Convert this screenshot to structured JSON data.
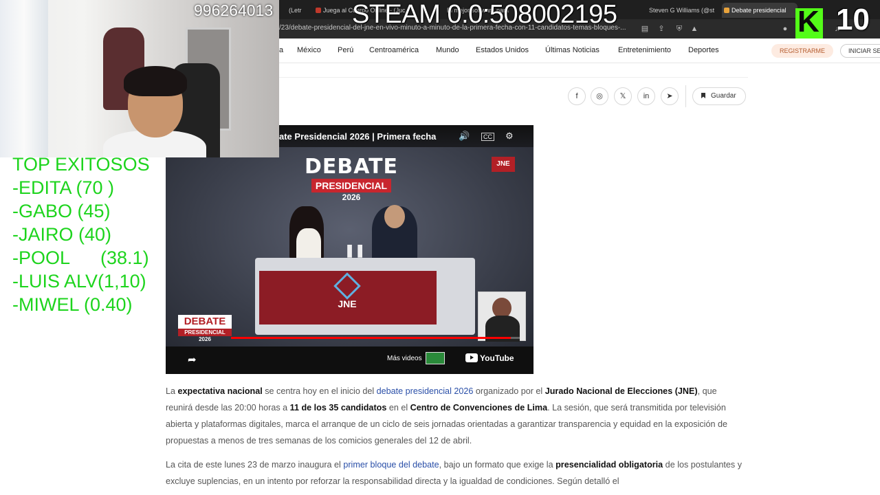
{
  "browser": {
    "tabs": [
      {
        "label": "(Letr"
      },
      {
        "label": "Juega al Cuerpo Online - (Juc"
      },
      {
        "label": "El mejor software para"
      },
      {
        "label": "Steven G Williams (@st"
      },
      {
        "label": "Debate presidencial"
      }
    ],
    "url": "/23/debate-presidencial-del-jne-en-vivo-minuto-a-minuto-de-la-primera-fecha-con-11-candidatos-temas-bloques-..."
  },
  "site_nav": {
    "items": [
      "México",
      "Perú",
      "Centroamérica",
      "Mundo",
      "Estados Unidos",
      "Últimas Noticias",
      "Entretenimiento",
      "Deportes"
    ],
    "register": "REGISTRARME",
    "login": "INICIAR SE"
  },
  "share": {
    "icons": [
      "f",
      "◎",
      "𝕏",
      "in",
      "➤"
    ],
    "save_label": "Guardar"
  },
  "video": {
    "title": "ate Presidencial 2026 | Primera fecha",
    "logo_word": "DEBATE",
    "logo_banner": "PRESIDENCIAL",
    "logo_year": "2026",
    "corner_logo": "JNE",
    "emblem_text": "JNE",
    "bug_word": "DEBATE",
    "bug_banner": "PRESIDENCIAL",
    "bug_year": "2026",
    "more_videos": "Más videos",
    "youtube": "YouTube",
    "progress": 0.97
  },
  "article": {
    "p1": [
      {
        "t": "La ",
        "s": "n"
      },
      {
        "t": "expectativa nacional",
        "s": "b"
      },
      {
        "t": " se centra hoy en el inicio del ",
        "s": "n"
      },
      {
        "t": "debate presidencial 2026",
        "s": "l"
      },
      {
        "t": " organizado por el ",
        "s": "n"
      },
      {
        "t": "Jurado Nacional de Elecciones (JNE)",
        "s": "b"
      },
      {
        "t": ", que reunirá desde las 20:00 horas a ",
        "s": "n"
      },
      {
        "t": "11 de los 35 candidatos",
        "s": "b"
      },
      {
        "t": " en el ",
        "s": "n"
      },
      {
        "t": "Centro de Convenciones de Lima",
        "s": "b"
      },
      {
        "t": ". La sesión, que será transmitida por televisión abierta y plataformas digitales, marca el arranque de un ciclo de seis jornadas orientadas a garantizar transparencia y equidad en la exposición de propuestas a menos de tres semanas de los comicios generales del 12 de abril.",
        "s": "n"
      }
    ],
    "p2": [
      {
        "t": "La cita de este lunes 23 de marzo inaugura el ",
        "s": "n"
      },
      {
        "t": "primer bloque del debate",
        "s": "l"
      },
      {
        "t": ", bajo un formato que exige la ",
        "s": "n"
      },
      {
        "t": "presencialidad obligatoria",
        "s": "b"
      },
      {
        "t": " de los postulantes y excluye suplencias, en un intento por reforzar la responsabilidad directa y la igualdad de condiciones. Según detalló el",
        "s": "n"
      }
    ]
  },
  "overlay": {
    "viewers": "996264013",
    "steam": "STEAM  0.0:508002195",
    "kick_letter": "K",
    "kick_number": "10",
    "top_title": "TOP EXITOSOS",
    "top_list": [
      "-EDITA (70 )",
      "-GABO (45)",
      "-JAIRO (40)",
      "-POOL      (38.1)",
      "-LUIS ALV(1,10)",
      "-MIWEL (0.40)"
    ]
  },
  "colors": {
    "accent_link": "#2a4fa8",
    "list_green": "#1dd41d",
    "kick_green": "#53fc18",
    "brand_red": "#b22026"
  }
}
